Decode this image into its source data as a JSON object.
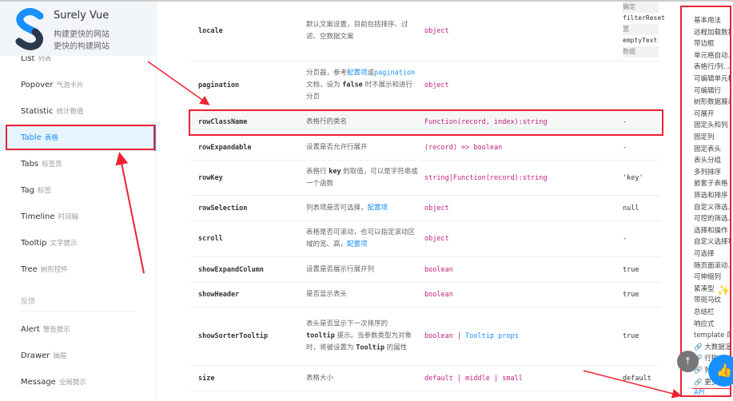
{
  "brand": {
    "title": "Surely Vue",
    "sub1": "构建更快的网站",
    "sub2": "更快的构建网站"
  },
  "sidebar": {
    "items": [
      {
        "en": "List",
        "zh": "列表"
      },
      {
        "en": "Popover",
        "zh": "气泡卡片"
      },
      {
        "en": "Statistic",
        "zh": "统计数值"
      },
      {
        "en": "Table",
        "zh": "表格"
      },
      {
        "en": "Tabs",
        "zh": "标签页"
      },
      {
        "en": "Tag",
        "zh": "标签"
      },
      {
        "en": "Timeline",
        "zh": "时间轴"
      },
      {
        "en": "Tooltip",
        "zh": "文字提示"
      },
      {
        "en": "Tree",
        "zh": "树形控件"
      }
    ],
    "group": "反馈",
    "items2": [
      {
        "en": "Alert",
        "zh": "警告提示"
      },
      {
        "en": "Drawer",
        "zh": "抽屉"
      },
      {
        "en": "Message",
        "zh": "全局提示"
      }
    ]
  },
  "table": {
    "rows": [
      {
        "name": "locale",
        "desc": "默认文案设置，目前包括排序、过滤、空数据文案",
        "type": "object",
        "default": ""
      },
      {
        "name": "pagination",
        "desc_a": "分页器，参考",
        "desc_link1": "配置项",
        "desc_b": "或",
        "desc_link2": "pagination",
        "desc_c": "文档，设为 ",
        "desc_code": "false",
        "desc_d": " 时不展示和进行分页",
        "type": "object",
        "default": ""
      },
      {
        "name": "rowClassName",
        "desc": "表格行的类名",
        "type": "Function(record, index):string",
        "default": "-"
      },
      {
        "name": "rowExpandable",
        "desc": "设置是否允许行展开",
        "type": "(record) => boolean",
        "default": "-"
      },
      {
        "name": "rowKey",
        "desc_a": "表格行 ",
        "desc_code": "key",
        "desc_b": " 的取值，可以是字符串或一个函数",
        "type": "string|Function(record):string",
        "default": "'key'"
      },
      {
        "name": "rowSelection",
        "desc": "列表项是否可选择，",
        "desc_link": "配置项",
        "type": "object",
        "default": "null"
      },
      {
        "name": "scroll",
        "desc": "表格是否可滚动，也可以指定滚动区域的宽、高，",
        "desc_link": "配置项",
        "type": "object",
        "default": "-"
      },
      {
        "name": "showExpandColumn",
        "desc": "设置是否展示行展开列",
        "type": "boolean",
        "default": "true"
      },
      {
        "name": "showHeader",
        "desc": "是否显示表头",
        "type": "boolean",
        "default": "true"
      },
      {
        "name": "showSorterTooltip",
        "desc_a": "表头是否显示下一次排序的 ",
        "desc_code1": "tooltip",
        "desc_b": " 提示。当参数类型为对象时，将被设置为 ",
        "desc_code2": "Tooltip",
        "desc_c": " 的属性",
        "type": "boolean",
        "type_sep": " | ",
        "type_link": "Tooltip props",
        "default": "true"
      },
      {
        "name": "size",
        "desc": "表格大小",
        "type": "default | middle | small",
        "default": "default"
      }
    ],
    "locale_default": [
      "确定",
      "filterReset",
      "置",
      "emptyText",
      "数据"
    ]
  },
  "anchor": [
    "基本用法",
    "远程加载数据",
    "带边框",
    "单元格自动...",
    "表格行/列...",
    "可编辑单元格",
    "可编辑行",
    "树形数据展示",
    "可展开",
    "固定头和列",
    "固定列",
    "固定表头",
    "表头分组",
    "多列排序",
    "嵌套子表格",
    "筛选和排序",
    "自定义筛选...",
    "可控的筛选...",
    "选择和操作",
    "自定义选择项",
    "可选择",
    "随页面滚动...",
    "可伸缩列",
    "紧凑型",
    "带斑马纹",
    "总结栏",
    "响应式",
    "template 风...",
    "🔗 大数据渲...",
    "🔗 行拖...",
    "🔗 列拖...",
    "🔗 更多功能",
    "API"
  ],
  "colors": {
    "accent": "#1890ff",
    "code": "#c41d7f",
    "annot": "#e23"
  }
}
